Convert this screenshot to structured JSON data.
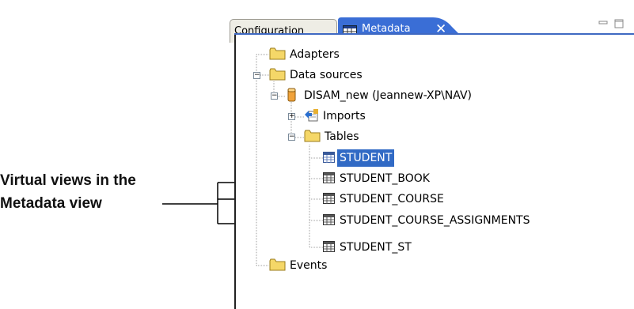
{
  "callout": {
    "line1": "Virtual views in the",
    "line2": "Metadata view"
  },
  "tabs": {
    "configuration": "Configuration",
    "metadata": "Metadata",
    "close": "✕"
  },
  "tree": {
    "adapters": "Adapters",
    "data_sources": "Data sources",
    "datasource_name": "DISAM_new (Jeannew-XP\\NAV)",
    "imports": "Imports",
    "tables": "Tables",
    "student": "STUDENT",
    "student_book": "STUDENT_BOOK",
    "student_course": "STUDENT_COURSE",
    "student_course_assignments": "STUDENT_COURSE_ASSIGNMENTS",
    "student_st": "STUDENT_ST",
    "events": "Events"
  },
  "colors": {
    "selection": "#316ac5",
    "folder": "#f5d768",
    "tab_active": "#3a6ed6"
  }
}
